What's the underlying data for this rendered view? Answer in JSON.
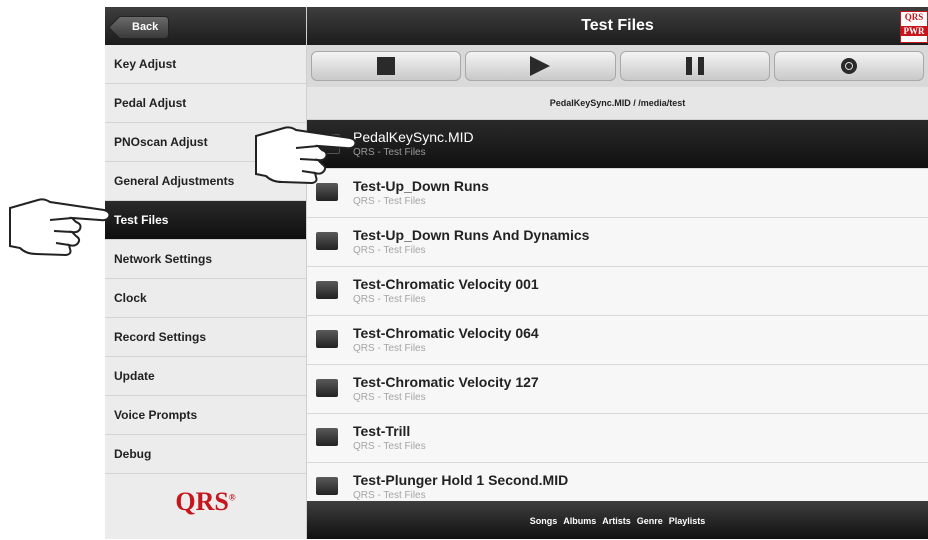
{
  "sidebar": {
    "back_label": "Back",
    "items": [
      {
        "label": "Key Adjust",
        "active": false
      },
      {
        "label": "Pedal Adjust",
        "active": false
      },
      {
        "label": "PNOscan Adjust",
        "active": false
      },
      {
        "label": "General Adjustments",
        "active": false
      },
      {
        "label": "Test Files",
        "active": true
      },
      {
        "label": "Network Settings",
        "active": false
      },
      {
        "label": "Clock",
        "active": false
      },
      {
        "label": "Record Settings",
        "active": false
      },
      {
        "label": "Update",
        "active": false
      },
      {
        "label": "Voice Prompts",
        "active": false
      },
      {
        "label": "Debug",
        "active": false
      }
    ],
    "logo": "QRS",
    "logo_mark": "®"
  },
  "header": {
    "title": "Test Files",
    "badge_top": "QRS",
    "badge_bottom": "PWR"
  },
  "controls": {
    "stop_icon": "stop-icon",
    "play_icon": "play-icon",
    "pause_icon": "pause-icon",
    "volume_icon": "volume-icon"
  },
  "now_playing": "PedalKeySync.MID / /media/test",
  "files": [
    {
      "title": "PedalKeySync.MID",
      "subtitle": "QRS - Test Files",
      "selected": true
    },
    {
      "title": "Test-Up_Down Runs",
      "subtitle": "QRS - Test Files",
      "selected": false
    },
    {
      "title": "Test-Up_Down Runs And Dynamics",
      "subtitle": "QRS - Test Files",
      "selected": false
    },
    {
      "title": "Test-Chromatic Velocity 001",
      "subtitle": "QRS - Test Files",
      "selected": false
    },
    {
      "title": "Test-Chromatic Velocity 064",
      "subtitle": "QRS - Test Files",
      "selected": false
    },
    {
      "title": "Test-Chromatic Velocity 127",
      "subtitle": "QRS - Test Files",
      "selected": false
    },
    {
      "title": "Test-Trill",
      "subtitle": "QRS - Test Files",
      "selected": false
    },
    {
      "title": "Test-Plunger Hold 1 Second.MID",
      "subtitle": "QRS - Test Files",
      "selected": false
    }
  ],
  "bottom_tabs": [
    "Songs",
    "Albums",
    "Artists",
    "Genre",
    "Playlists"
  ],
  "colors": {
    "brand": "#c4161c",
    "bar": "#1c1c1c"
  }
}
